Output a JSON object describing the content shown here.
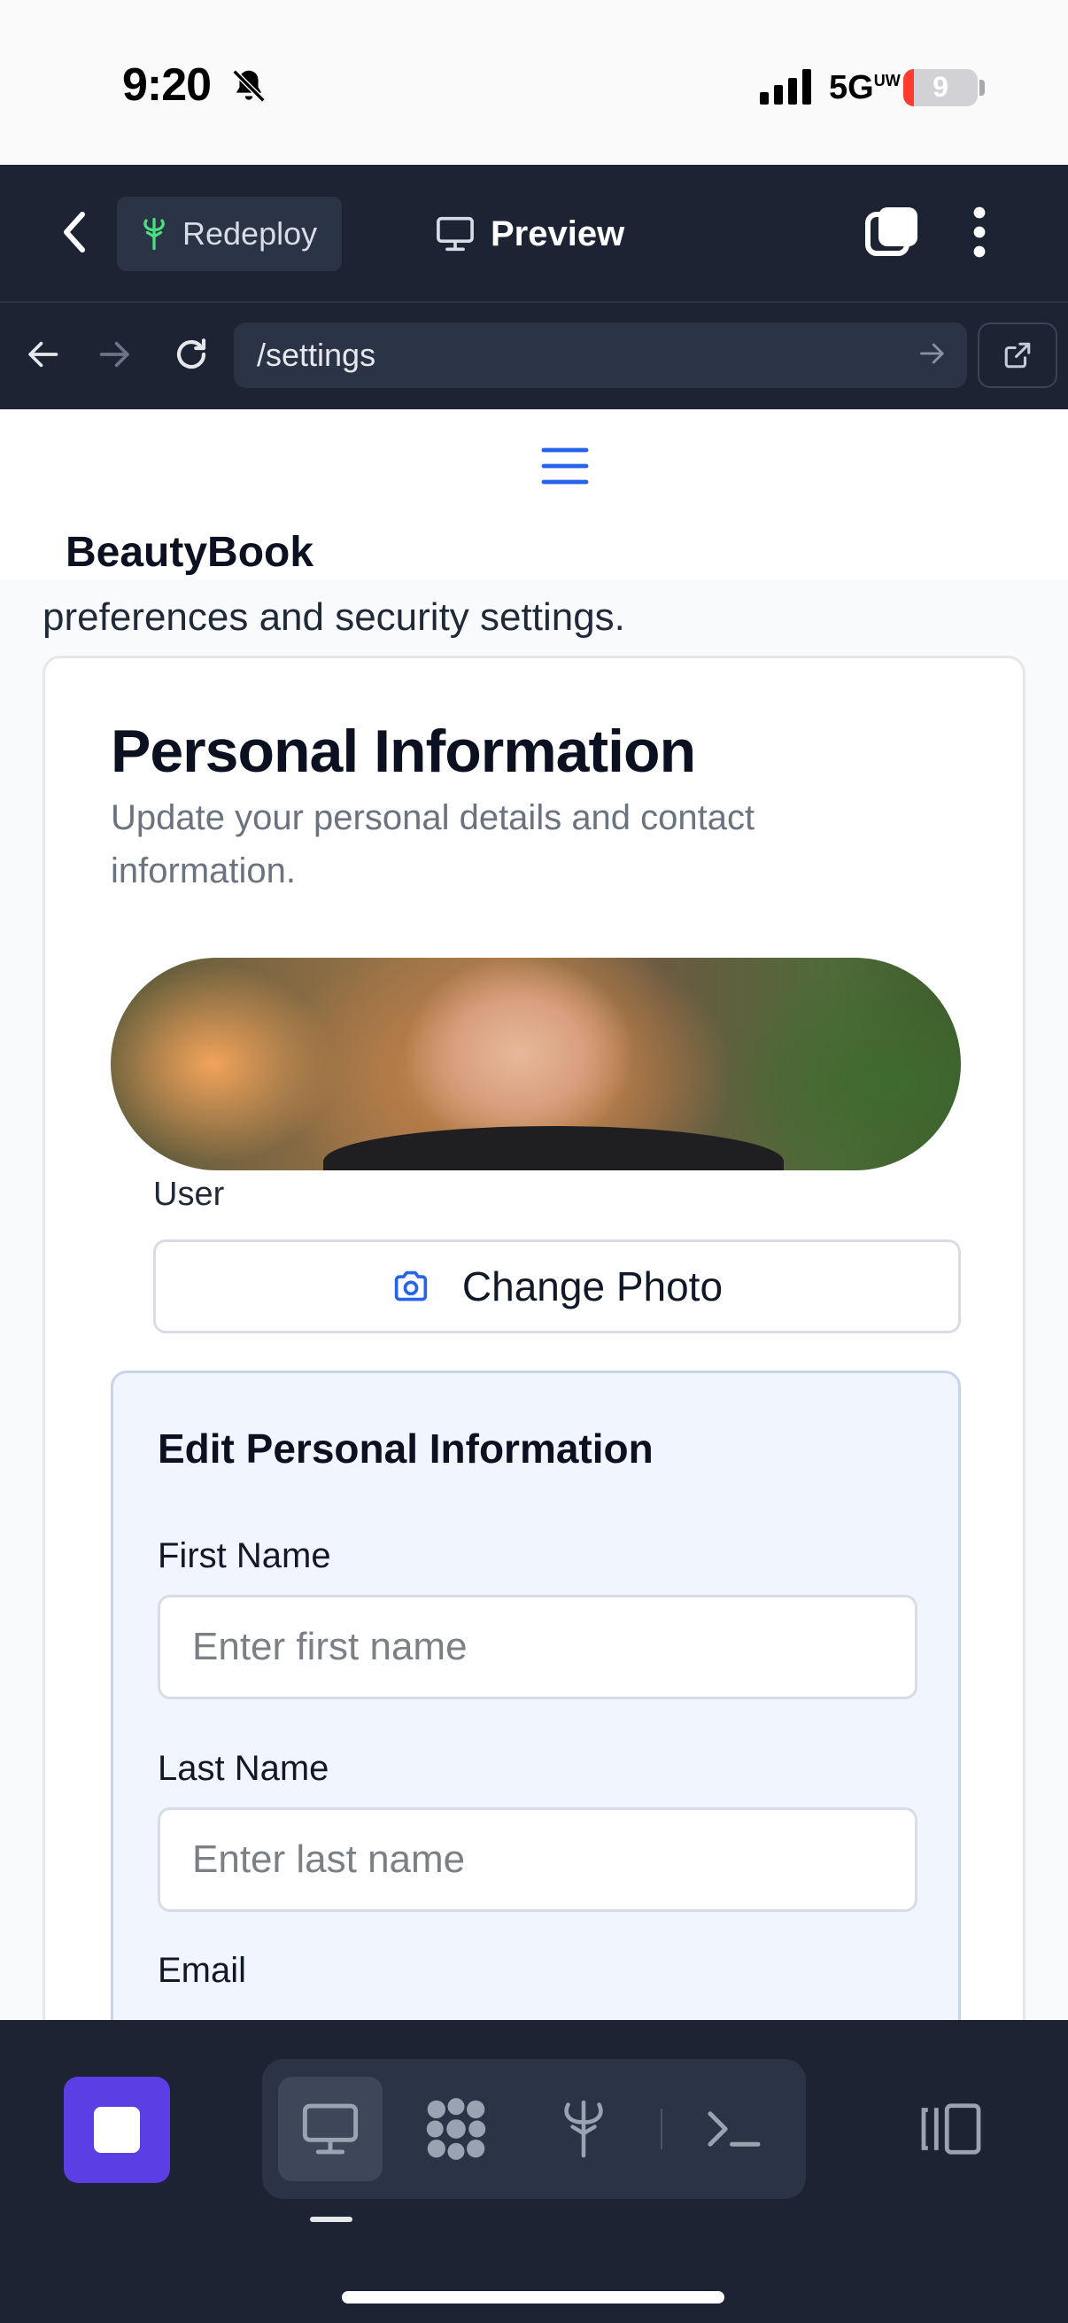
{
  "status_bar": {
    "time": "9:20",
    "network": "5G",
    "network_sub": "UW",
    "battery_level": "9"
  },
  "app_bar": {
    "redeploy_label": "Redeploy",
    "preview_label": "Preview"
  },
  "url_bar": {
    "path": "/settings"
  },
  "site": {
    "brand": "BeautyBook",
    "subtitle_tail": "preferences and security settings."
  },
  "personal_info": {
    "title": "Personal Information",
    "description": "Update your personal details and contact information.",
    "photo_caption": "User",
    "change_photo_label": "Change Photo"
  },
  "edit_form": {
    "title": "Edit Personal Information",
    "first_name_label": "First Name",
    "first_name_placeholder": "Enter first name",
    "first_name_value": "",
    "last_name_label": "Last Name",
    "last_name_placeholder": "Enter last name",
    "last_name_value": "",
    "email_label": "Email"
  },
  "colors": {
    "app_bar_bg": "#1c2333",
    "accent_purple": "#5b3fe4",
    "link_blue": "#2563eb",
    "form_panel_bg": "#f1f5fd"
  },
  "icons": {
    "back": "chevron-left-icon",
    "redeploy": "deploy-tree-icon",
    "preview": "monitor-icon",
    "tabs": "tabs-icon",
    "more": "vertical-dots-icon",
    "nav_back": "arrow-left-icon",
    "nav_forward": "arrow-right-icon",
    "reload": "reload-icon",
    "go": "arrow-right-icon",
    "open_external": "external-link-icon",
    "menu": "hamburger-icon",
    "camera": "camera-icon",
    "tools": [
      "monitor-icon",
      "packages-icon",
      "deploy-tree-icon",
      "terminal-icon"
    ],
    "layout": "panel-layout-icon"
  }
}
